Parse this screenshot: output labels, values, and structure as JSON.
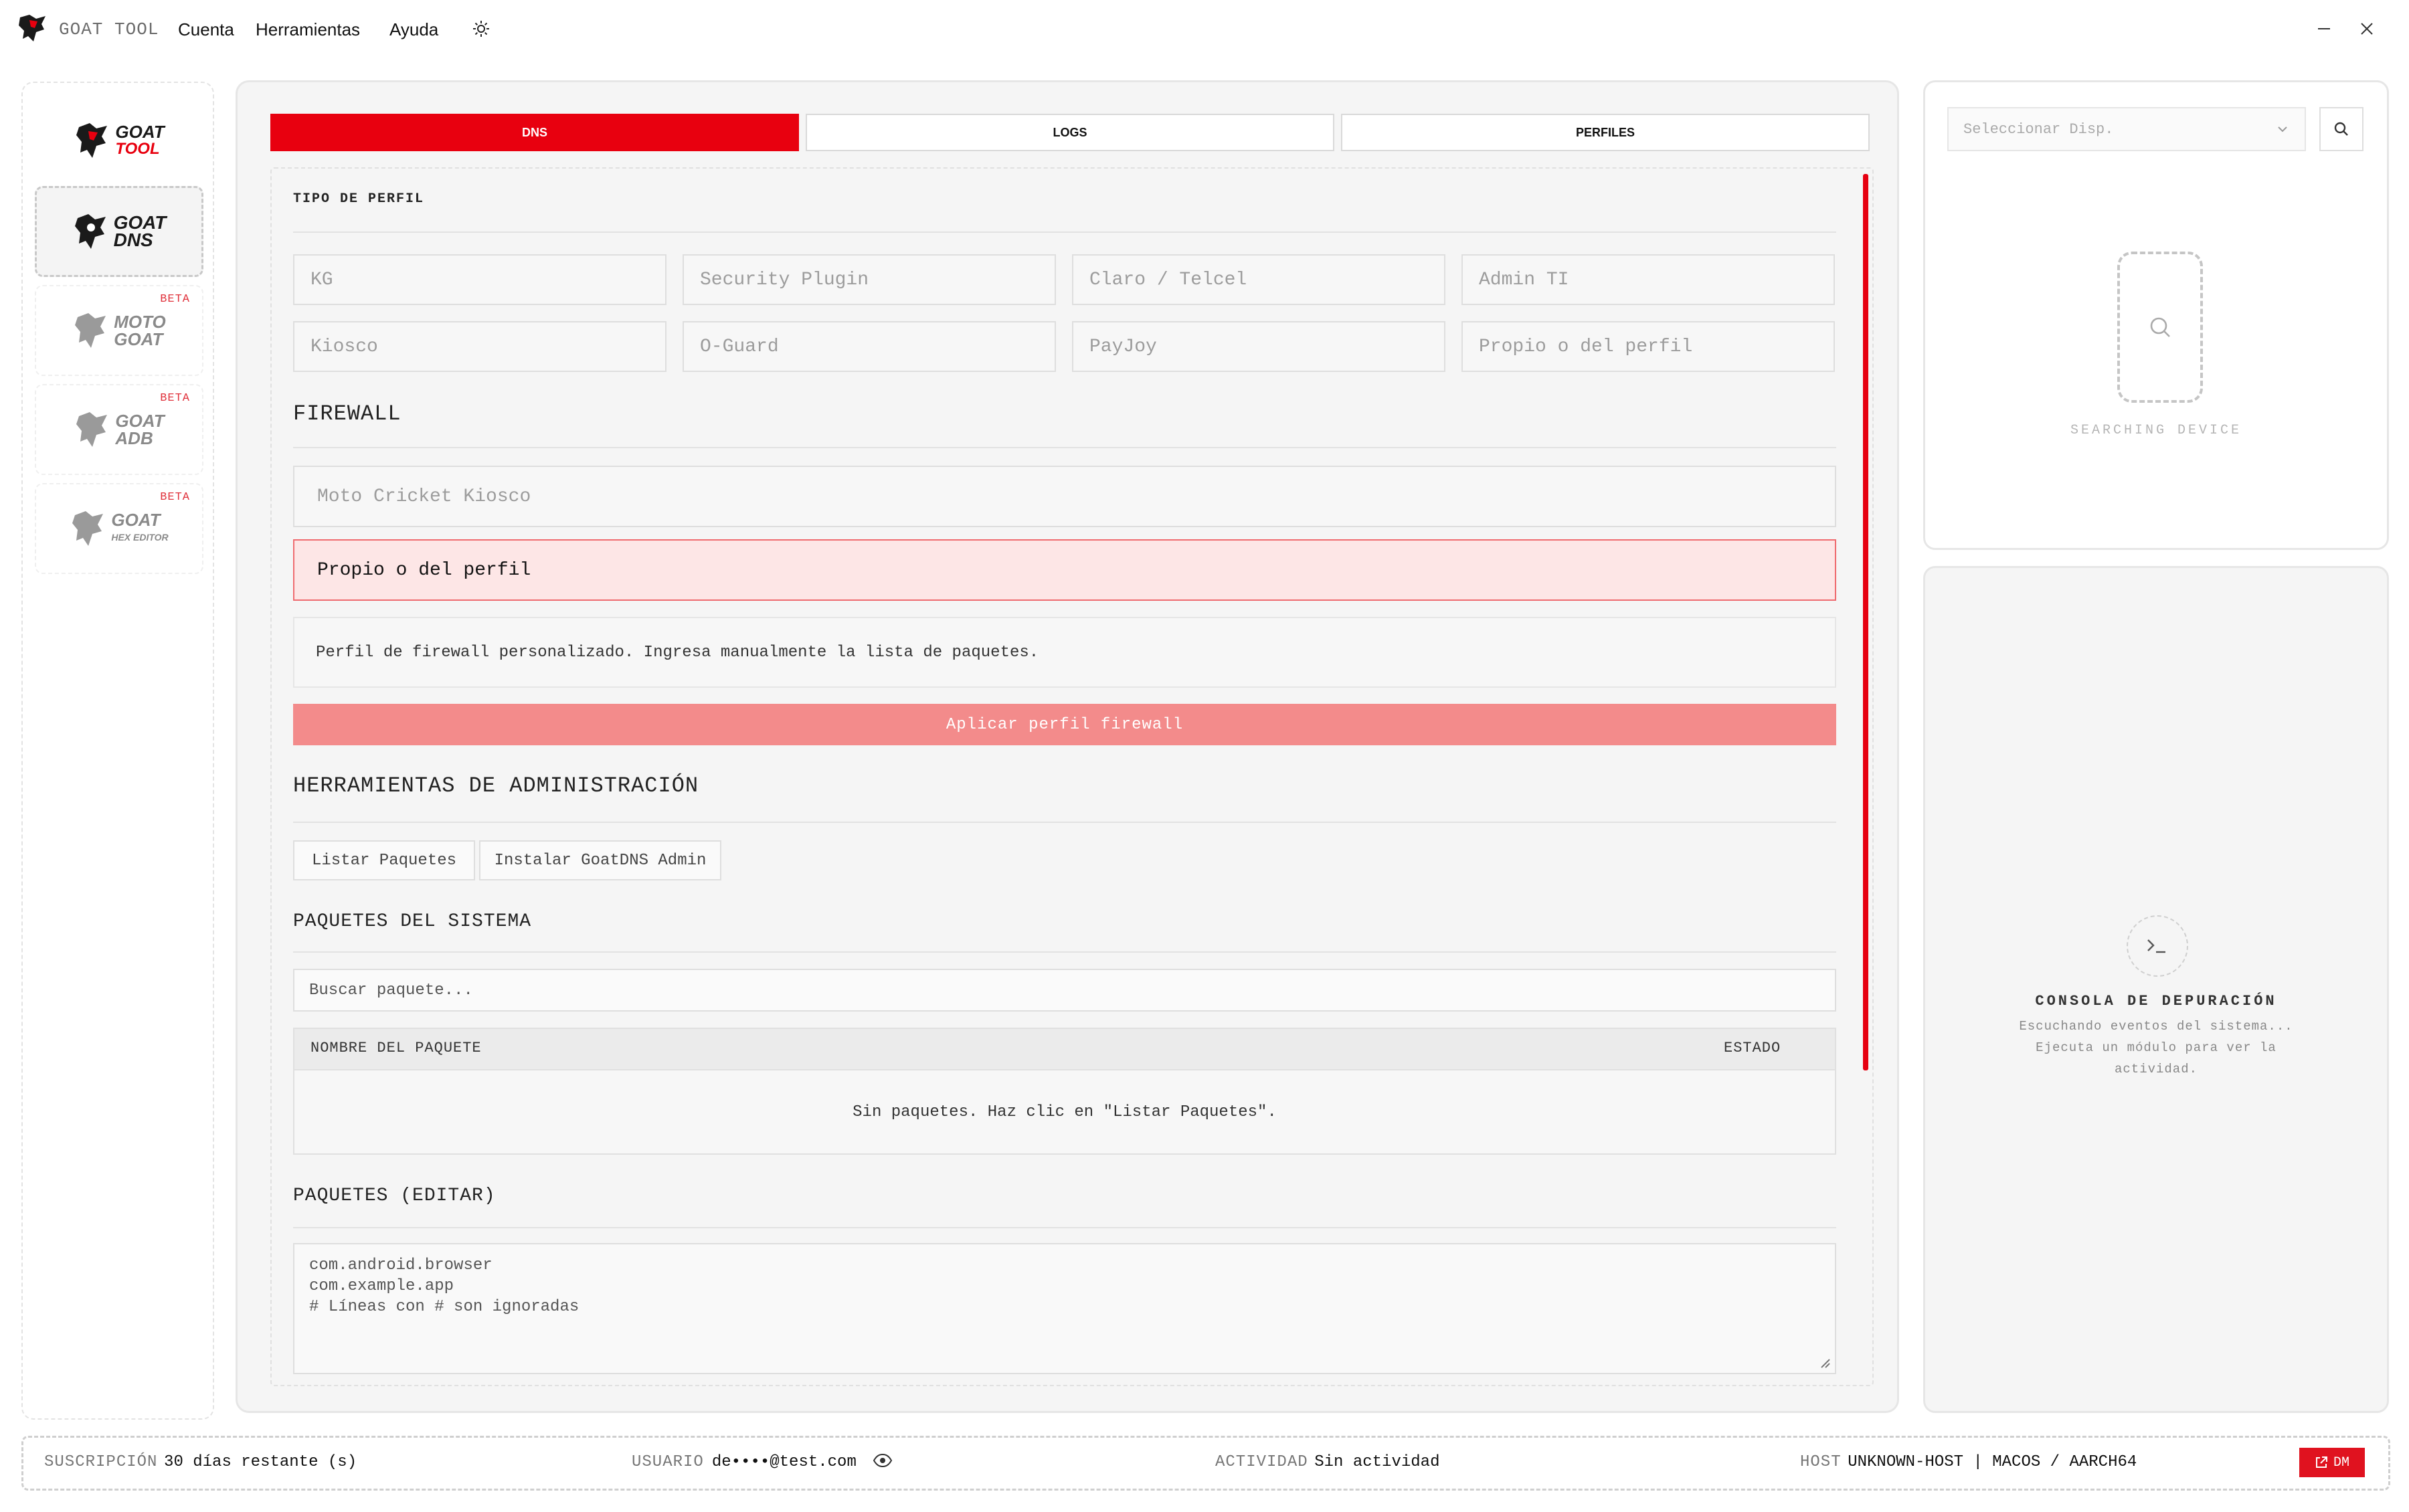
{
  "app": {
    "title": "GOAT TOOL",
    "menu": [
      "Cuenta",
      "Herramientas",
      "Ayuda"
    ]
  },
  "sidebar": {
    "items": [
      {
        "line1": "GOAT",
        "line2": "TOOL",
        "beta": ""
      },
      {
        "line1": "GOAT",
        "line2": "DNS",
        "beta": ""
      },
      {
        "line1": "MOTO",
        "line2": "GOAT",
        "beta": "BETA"
      },
      {
        "line1": "GOAT",
        "line2": "ADB",
        "beta": "BETA"
      },
      {
        "line1": "GOAT",
        "line2": "HEX EDITOR",
        "beta": "BETA"
      }
    ]
  },
  "tabs": [
    "DNS",
    "LOGS",
    "PERFILES"
  ],
  "profile": {
    "label": "TIPO DE PERFIL",
    "options": [
      "KG",
      "Security Plugin",
      "Claro / Telcel",
      "Admin TI",
      "Kiosco",
      "O-Guard",
      "PayJoy",
      "Propio o del perfil"
    ]
  },
  "firewall": {
    "title": "FIREWALL",
    "option1": "Moto Cricket Kiosco",
    "option2": "Propio o del perfil",
    "description": "Perfil de firewall personalizado. Ingresa manualmente la lista de paquetes.",
    "apply": "Aplicar perfil firewall"
  },
  "admin": {
    "title": "HERRAMIENTAS DE ADMINISTRACIÓN",
    "list_button": "Listar Paquetes",
    "install_button": "Instalar GoatDNS Admin"
  },
  "packages": {
    "title": "PAQUETES DEL SISTEMA",
    "search_placeholder": "Buscar paquete...",
    "col_name": "NOMBRE DEL PAQUETE",
    "col_status": "ESTADO",
    "empty": "Sin paquetes. Haz clic en \"Listar Paquetes\"."
  },
  "edit": {
    "title": "PAQUETES (EDITAR)",
    "text": "com.android.browser\ncom.example.app\n# Líneas con # son ignoradas"
  },
  "device": {
    "select_placeholder": "Seleccionar Disp.",
    "searching": "SEARCHING DEVICE"
  },
  "console": {
    "title": "CONSOLA DE DEPURACIÓN",
    "sub": "Escuchando eventos del sistema... Ejecuta un módulo para ver la actividad."
  },
  "status": {
    "sub_label": "SUSCRIPCIÓN",
    "sub_value": "30 días restante (s)",
    "user_label": "USUARIO",
    "user_value": "de••••@test.com",
    "activity_label": "ACTIVIDAD",
    "activity_value": "Sin actividad",
    "host_label": "HOST",
    "host_value": "UNKNOWN-HOST | MACOS / AARCH64",
    "dm": "DM"
  },
  "colors": {
    "accent": "#e8000f",
    "apply": "#f38b8b",
    "selected_bg": "#fde6e6"
  }
}
